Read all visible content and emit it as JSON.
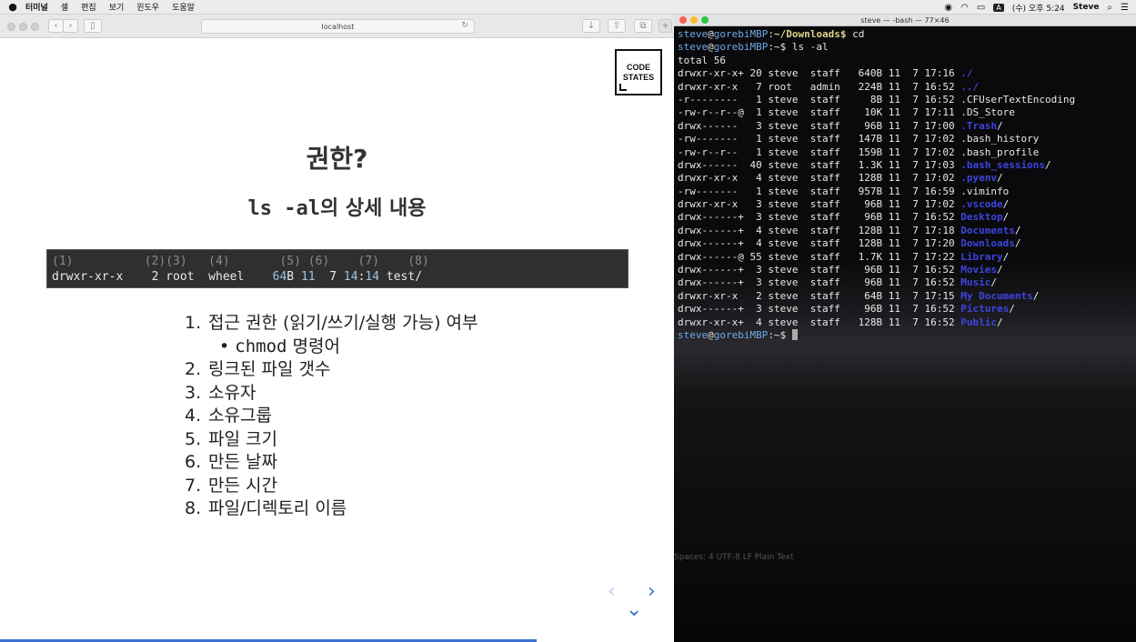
{
  "menubar": {
    "apple": "",
    "app": "터미널",
    "items": [
      "셸",
      "편집",
      "보기",
      "윈도우",
      "도움말"
    ],
    "clock": "(수) 오후 5:24",
    "user": "Steve",
    "input": "A"
  },
  "browser": {
    "url": "localhost",
    "slide": {
      "logo_line1": "CODE",
      "logo_line2": "STATES",
      "title": "권한?",
      "subtitle_code": "ls -al",
      "subtitle_text": "의 상세 내용",
      "code_line1": "(1)          (2)(3)   (4)       (5) (6)    (7)    (8)",
      "code_line2_a": "drwxr-xr-x    2 root  wheel    ",
      "code_line2_hl1": "64",
      "code_line2_b": "B ",
      "code_line2_hl2": "11",
      "code_line2_c": "  7 ",
      "code_line2_hl3": "14",
      "code_line2_d": ":",
      "code_line2_hl4": "14",
      "code_line2_e": " test/",
      "list": [
        {
          "n": "1.",
          "t": "접근 권한 (읽기/쓰기/실행 가능) 여부"
        },
        {
          "n": "2.",
          "t": "링크된 파일 갯수"
        },
        {
          "n": "3.",
          "t": "소유자"
        },
        {
          "n": "4.",
          "t": "소유그룹"
        },
        {
          "n": "5.",
          "t": "파일 크기"
        },
        {
          "n": "6.",
          "t": "만든 날짜"
        },
        {
          "n": "7.",
          "t": "만든 시간"
        },
        {
          "n": "8.",
          "t": "파일/디렉토리 이름"
        }
      ],
      "sub_bullet_code": "chmod",
      "sub_bullet_text": " 명령어"
    }
  },
  "terminal": {
    "title": "steve — -bash — 77×46",
    "prompt_user": "steve",
    "prompt_host": "gorebiMBP",
    "lines": [
      {
        "p": "~/Downloads$ ",
        "cmd": "cd",
        "dl": true
      },
      {
        "p": "~$ ",
        "cmd": "ls -al"
      },
      {
        "t": "total 56"
      },
      {
        "t": "drwxr-xr-x+ 20 steve  staff   640B 11  7 17:16 ",
        "d": "./"
      },
      {
        "t": "drwxr-xr-x   7 root   admin   224B 11  7 16:52 ",
        "d": "../"
      },
      {
        "t": "-r--------   1 steve  staff     8B 11  7 16:52 .CFUserTextEncoding"
      },
      {
        "t": "-rw-r--r--@  1 steve  staff    10K 11  7 17:11 .DS_Store"
      },
      {
        "t": "drwx------   3 steve  staff    96B 11  7 17:00 ",
        "d": ".Trash",
        "s": "/"
      },
      {
        "t": "-rw-------   1 steve  staff   147B 11  7 17:02 .bash_history"
      },
      {
        "t": "-rw-r--r--   1 steve  staff   159B 11  7 17:02 .bash_profile"
      },
      {
        "t": "drwx------  40 steve  staff   1.3K 11  7 17:03 ",
        "d": ".bash_sessions",
        "s": "/"
      },
      {
        "t": "drwxr-xr-x   4 steve  staff   128B 11  7 17:02 ",
        "d": ".pyenv",
        "s": "/"
      },
      {
        "t": "-rw-------   1 steve  staff   957B 11  7 16:59 .viminfo"
      },
      {
        "t": "drwxr-xr-x   3 steve  staff    96B 11  7 17:02 ",
        "d": ".vscode",
        "s": "/"
      },
      {
        "t": "drwx------+  3 steve  staff    96B 11  7 16:52 ",
        "d": "Desktop",
        "s": "/"
      },
      {
        "t": "drwx------+  4 steve  staff   128B 11  7 17:18 ",
        "d": "Documents",
        "s": "/"
      },
      {
        "t": "drwx------+  4 steve  staff   128B 11  7 17:20 ",
        "d": "Downloads",
        "s": "/"
      },
      {
        "t": "drwx------@ 55 steve  staff   1.7K 11  7 17:22 ",
        "d": "Library",
        "s": "/"
      },
      {
        "t": "drwx------+  3 steve  staff    96B 11  7 16:52 ",
        "d": "Movies",
        "s": "/"
      },
      {
        "t": "drwx------+  3 steve  staff    96B 11  7 16:52 ",
        "d": "Music",
        "s": "/"
      },
      {
        "t": "drwxr-xr-x   2 steve  staff    64B 11  7 17:15 ",
        "d": "My Documents",
        "s": "/"
      },
      {
        "t": "drwx------+  3 steve  staff    96B 11  7 16:52 ",
        "d": "Pictures",
        "s": "/"
      },
      {
        "t": "drwxr-xr-x+  4 steve  staff   128B 11  7 16:52 ",
        "d": "Public",
        "s": "/"
      },
      {
        "p": "~$ ",
        "cmd": "",
        "cursor": true
      }
    ],
    "ghost_status": "Spaces: 4   UTF-8   LF   Plain Text"
  },
  "colors": {
    "accent": "#3b6fd1",
    "dir": "#3d44e0",
    "prompt": "#6ea9e6"
  }
}
